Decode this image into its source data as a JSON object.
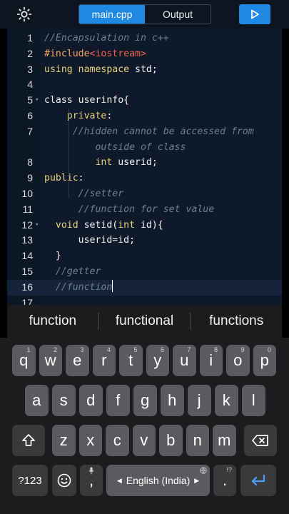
{
  "header": {
    "settings_icon": "gear-icon",
    "tabs": [
      {
        "label": "main.cpp",
        "active": true
      },
      {
        "label": "Output",
        "active": false
      }
    ],
    "run_icon": "play-icon"
  },
  "editor": {
    "lines": [
      {
        "num": "1",
        "fold": "",
        "segments": [
          {
            "t": "//Encapsulation in c++",
            "c": "cm"
          }
        ]
      },
      {
        "num": "2",
        "fold": "",
        "segments": [
          {
            "t": "#include",
            "c": "pp"
          },
          {
            "t": "<iostream>",
            "c": "inc"
          }
        ]
      },
      {
        "num": "3",
        "fold": "",
        "segments": [
          {
            "t": "using namespace",
            "c": "kw"
          },
          {
            "t": " std;",
            "c": "tx"
          }
        ]
      },
      {
        "num": "4",
        "fold": "",
        "segments": []
      },
      {
        "num": "5",
        "fold": "v",
        "segments": [
          {
            "t": "class userinfo{",
            "c": "tx"
          }
        ]
      },
      {
        "num": "6",
        "fold": "",
        "segments": [
          {
            "t": "    private",
            "c": "kw"
          },
          {
            "t": ":",
            "c": "tx"
          }
        ]
      },
      {
        "num": "7",
        "fold": "",
        "segments": [
          {
            "t": "     //hidden cannot be accessed from",
            "c": "cm"
          }
        ]
      },
      {
        "num": "",
        "fold": "",
        "segments": [
          {
            "t": "         outside of class",
            "c": "cm"
          }
        ]
      },
      {
        "num": "8",
        "fold": "",
        "segments": [
          {
            "t": "         int",
            "c": "kw"
          },
          {
            "t": " userid;",
            "c": "tx"
          }
        ]
      },
      {
        "num": "9",
        "fold": "",
        "segments": [
          {
            "t": "public",
            "c": "kw"
          },
          {
            "t": ":",
            "c": "tx"
          }
        ]
      },
      {
        "num": "10",
        "fold": "",
        "segments": [
          {
            "t": "      //setter",
            "c": "cm"
          }
        ]
      },
      {
        "num": "11",
        "fold": "",
        "segments": [
          {
            "t": "      //function for set value",
            "c": "cm"
          }
        ]
      },
      {
        "num": "12",
        "fold": "v",
        "segments": [
          {
            "t": "  void",
            "c": "kw"
          },
          {
            "t": " setid(",
            "c": "tx"
          },
          {
            "t": "int",
            "c": "kw"
          },
          {
            "t": " id){",
            "c": "tx"
          }
        ]
      },
      {
        "num": "13",
        "fold": "",
        "segments": [
          {
            "t": "      userid=id;",
            "c": "tx"
          }
        ]
      },
      {
        "num": "14",
        "fold": "",
        "segments": [
          {
            "t": "  }",
            "c": "tx"
          }
        ]
      },
      {
        "num": "15",
        "fold": "",
        "segments": [
          {
            "t": "  //getter",
            "c": "cm"
          }
        ]
      },
      {
        "num": "16",
        "fold": "",
        "segments": [
          {
            "t": "  //function",
            "c": "cm"
          }
        ],
        "current": true
      },
      {
        "num": "17",
        "fold": "",
        "segments": []
      }
    ]
  },
  "suggestions": [
    "function",
    "functional",
    "functions"
  ],
  "keyboard": {
    "row1": [
      {
        "k": "q",
        "s": "1"
      },
      {
        "k": "w",
        "s": "2"
      },
      {
        "k": "e",
        "s": "3"
      },
      {
        "k": "r",
        "s": "4"
      },
      {
        "k": "t",
        "s": "5"
      },
      {
        "k": "y",
        "s": "6"
      },
      {
        "k": "u",
        "s": "7"
      },
      {
        "k": "i",
        "s": "8"
      },
      {
        "k": "o",
        "s": "9"
      },
      {
        "k": "p",
        "s": "0"
      }
    ],
    "row2": [
      "a",
      "s",
      "d",
      "f",
      "g",
      "h",
      "j",
      "k",
      "l"
    ],
    "row3": [
      "z",
      "x",
      "c",
      "v",
      "b",
      "n",
      "m"
    ],
    "symbols_label": "?123",
    "comma": ",",
    "space_label": "English (India)",
    "period": ".",
    "period_sup": "!?",
    "shift_icon": "shift-icon",
    "backspace_icon": "backspace-icon",
    "emoji_icon": "emoji-icon",
    "mic_icon": "mic-icon",
    "globe_icon": "globe-icon",
    "enter_icon": "enter-icon"
  },
  "colors": {
    "accent": "#1e88e5",
    "editor_bg": "#0e1a2a",
    "comment": "#6e7f92",
    "keyword": "#e8d479",
    "include": "#f06050"
  }
}
